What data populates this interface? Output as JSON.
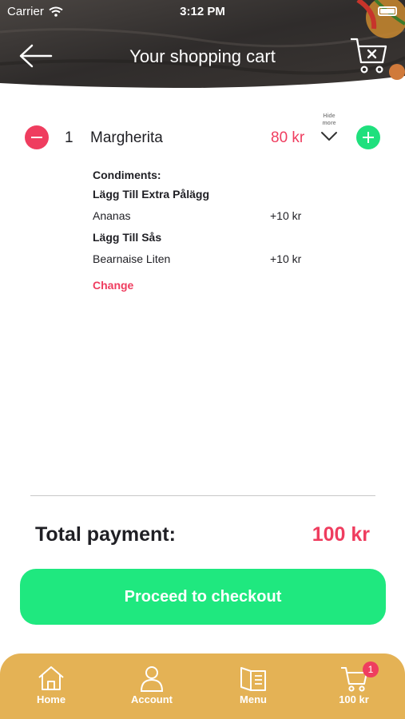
{
  "status_bar": {
    "carrier": "Carrier",
    "time": "3:12 PM"
  },
  "header": {
    "title": "Your shopping cart",
    "back_icon": "back-arrow-icon",
    "clear_cart_icon": "cart-clear-icon"
  },
  "cart_item": {
    "quantity": "1",
    "name": "Margherita",
    "price": "80 kr",
    "toggle_label_line1": "Hide",
    "toggle_label_line2": "more",
    "condiments_label": "Condiments:",
    "groups": [
      {
        "title": "Lägg Till Extra Pålägg",
        "option": "Ananas",
        "price": "+10 kr"
      },
      {
        "title": "Lägg Till Sås",
        "option": "Bearnaise Liten",
        "price": "+10 kr"
      }
    ],
    "change_label": "Change"
  },
  "total": {
    "label": "Total payment:",
    "value": "100 kr"
  },
  "checkout_label": "Proceed to checkout",
  "tab_bar": {
    "tabs": [
      {
        "label": "Home",
        "icon": "home-icon"
      },
      {
        "label": "Account",
        "icon": "account-icon"
      },
      {
        "label": "Menu",
        "icon": "menu-book-icon"
      },
      {
        "label": "100 kr",
        "icon": "cart-icon",
        "badge": "1"
      }
    ]
  },
  "colors": {
    "accent_red": "#ef3d5f",
    "accent_green": "#1fe07d",
    "tab_bar": "#e4b255"
  }
}
